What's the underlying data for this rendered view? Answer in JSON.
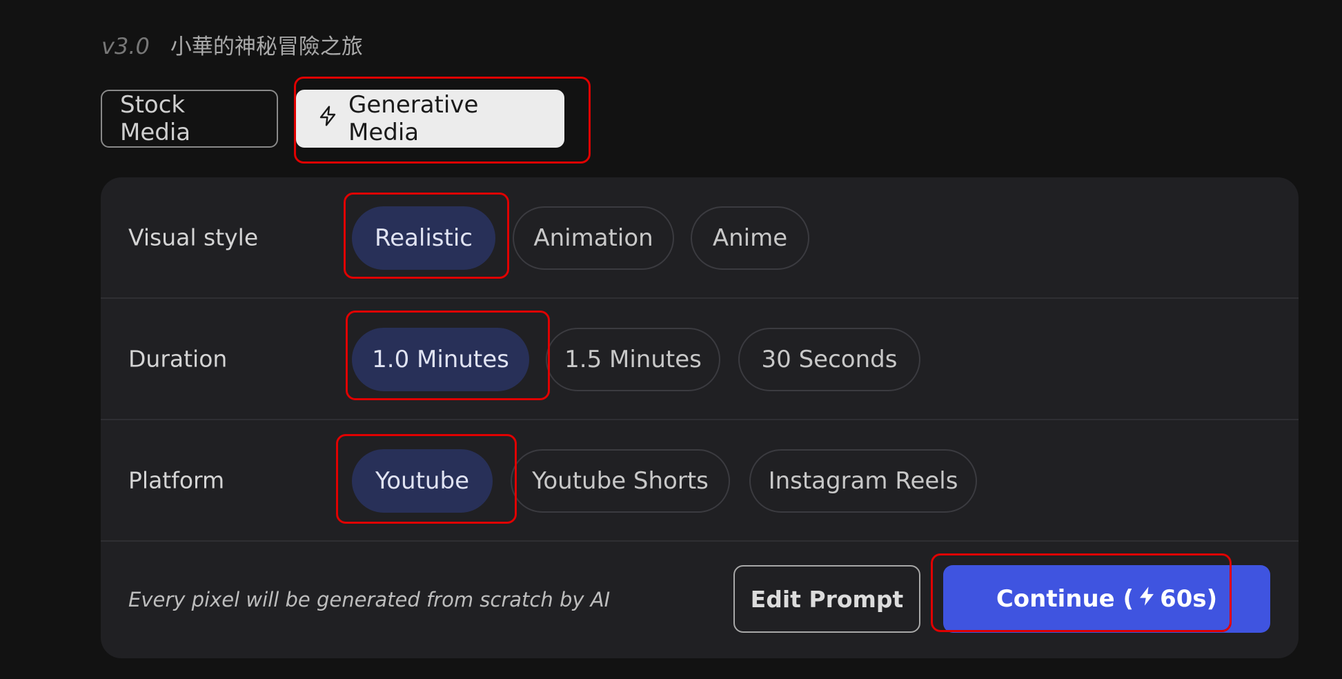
{
  "header": {
    "version": "v3.0",
    "project_title": "小華的神秘冒險之旅"
  },
  "media_tabs": [
    {
      "label": "Stock Media",
      "selected": false
    },
    {
      "label": "Generative Media",
      "selected": true,
      "icon": "lightning-icon"
    }
  ],
  "visual_style": {
    "label": "Visual style",
    "options": [
      {
        "label": "Realistic",
        "selected": true
      },
      {
        "label": "Animation",
        "selected": false
      },
      {
        "label": "Anime",
        "selected": false
      }
    ]
  },
  "duration": {
    "label": "Duration",
    "options": [
      {
        "label": "1.0 Minutes",
        "selected": true
      },
      {
        "label": "1.5 Minutes",
        "selected": false
      },
      {
        "label": "30 Seconds",
        "selected": false
      }
    ]
  },
  "platform": {
    "label": "Platform",
    "options": [
      {
        "label": "Youtube",
        "selected": true
      },
      {
        "label": "Youtube Shorts",
        "selected": false
      },
      {
        "label": "Instagram Reels",
        "selected": false
      }
    ]
  },
  "footer": {
    "note": "Every pixel will be generated from scratch by AI",
    "edit_prompt_label": "Edit Prompt",
    "continue_prefix": "Continue (",
    "continue_cost": "60s)",
    "continue_icon": "lightning-icon"
  },
  "colors": {
    "background": "#121212",
    "panel": "#202023",
    "selected_pill": "#283058",
    "primary_button": "#3f54e0",
    "annotation": "#e00000"
  }
}
